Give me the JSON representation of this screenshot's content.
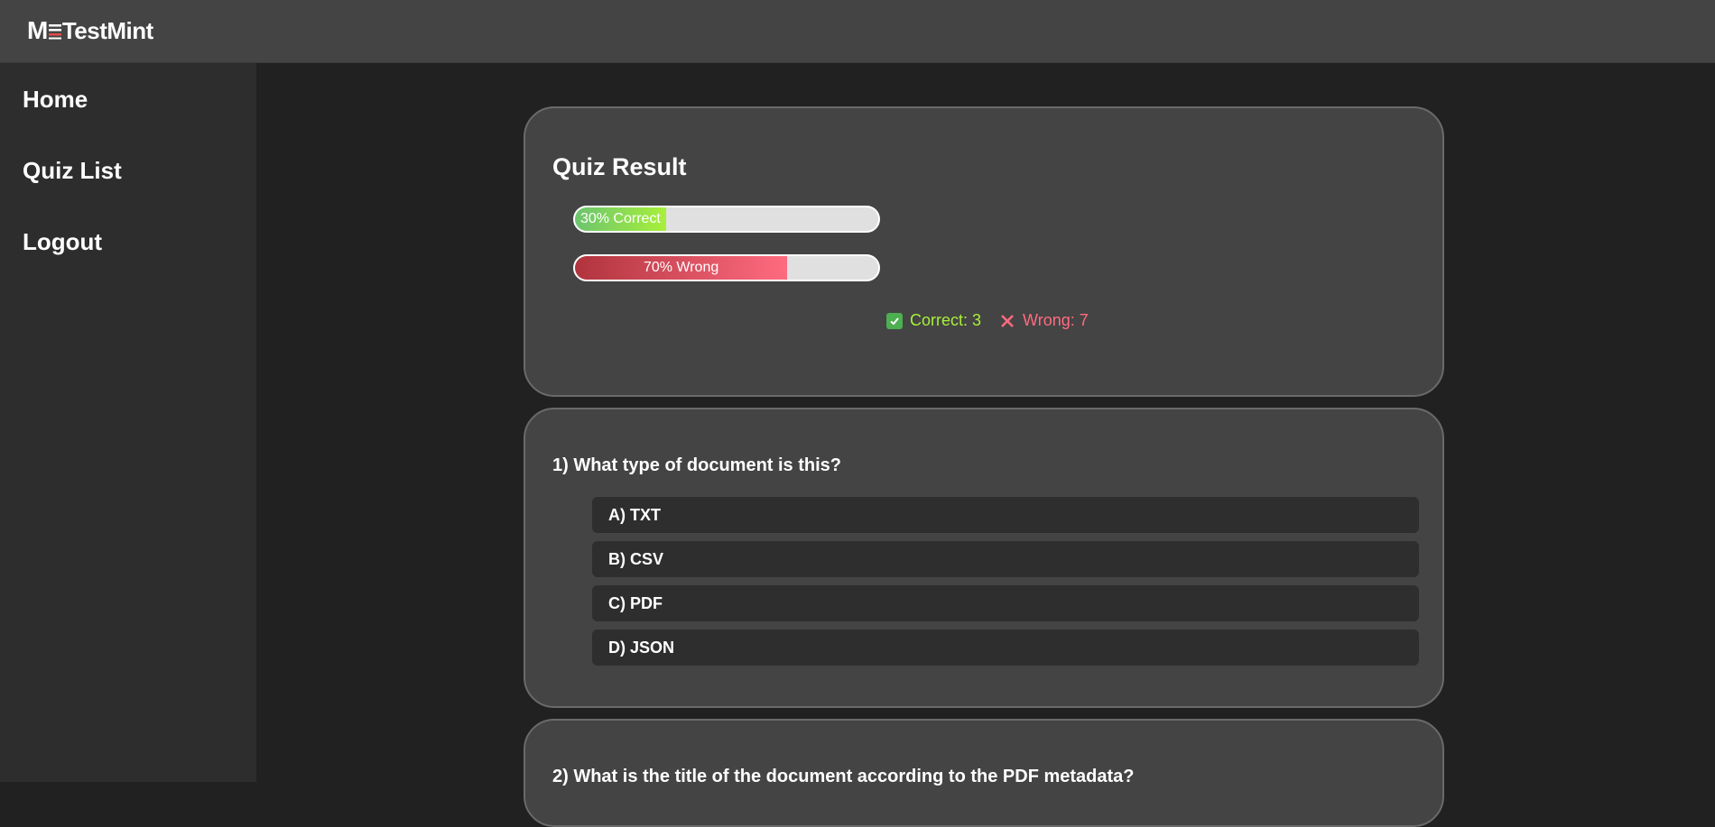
{
  "app": {
    "brand_prefix": "M",
    "brand_name": "TestMint"
  },
  "sidebar": {
    "items": [
      {
        "label": "Home"
      },
      {
        "label": "Quiz List"
      },
      {
        "label": "Logout"
      }
    ]
  },
  "result": {
    "title": "Quiz Result",
    "correct_percent": 30,
    "wrong_percent": 70,
    "correct_bar_label": "30% Correct",
    "wrong_bar_label": "70% Wrong",
    "correct_summary": "Correct: 3",
    "wrong_summary": "Wrong: 7"
  },
  "questions": [
    {
      "text": "1) What type of document is this?",
      "options": [
        "A) TXT",
        "B) CSV",
        "C) PDF",
        "D) JSON"
      ]
    },
    {
      "text": "2) What is the title of the document according to the PDF metadata?"
    }
  ],
  "colors": {
    "correct": "#a8f03a",
    "wrong": "#ff6b80",
    "card": "#444444",
    "background": "#212121",
    "sidebar": "#2d2d2d"
  }
}
